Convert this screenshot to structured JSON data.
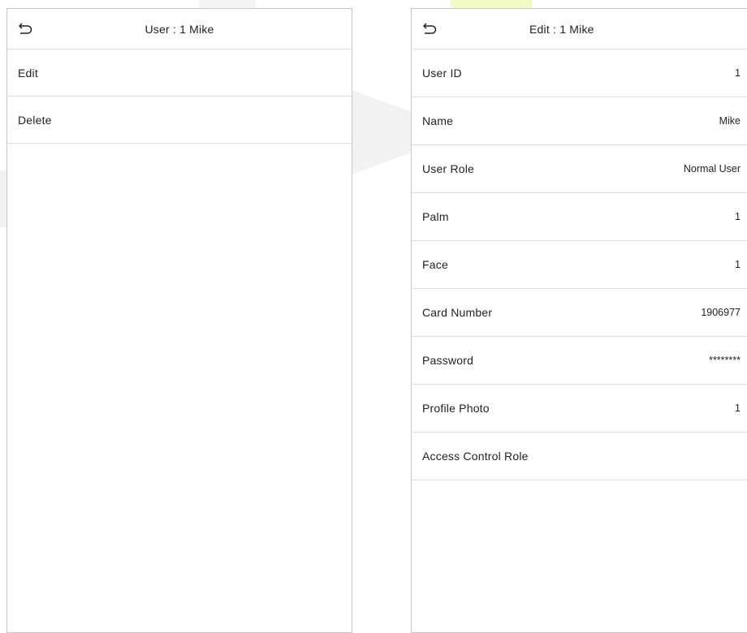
{
  "left_panel": {
    "title": "User : 1 Mike",
    "items": [
      {
        "label": "Edit"
      },
      {
        "label": "Delete"
      }
    ]
  },
  "right_panel": {
    "title": "Edit : 1 Mike",
    "fields": [
      {
        "label": "User ID",
        "value": "1"
      },
      {
        "label": "Name",
        "value": "Mike"
      },
      {
        "label": "User Role",
        "value": "Normal User"
      },
      {
        "label": "Palm",
        "value": "1"
      },
      {
        "label": "Face",
        "value": "1"
      },
      {
        "label": "Card Number",
        "value": "1906977"
      },
      {
        "label": "Password",
        "value": "********"
      },
      {
        "label": "Profile Photo",
        "value": "1"
      },
      {
        "label": "Access Control Role",
        "value": ""
      }
    ]
  },
  "icons": {
    "back": "back-arrow-icon"
  }
}
